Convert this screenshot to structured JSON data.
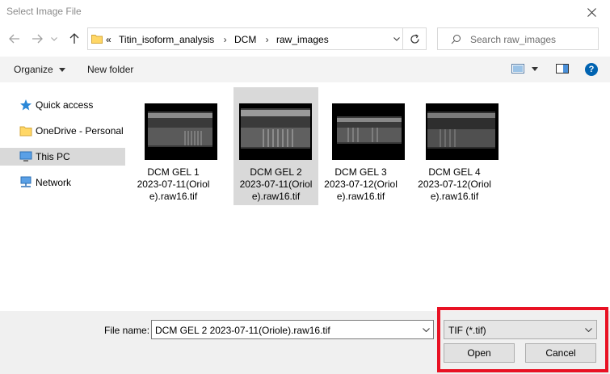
{
  "window": {
    "title": "Select Image File"
  },
  "address": {
    "chevron": "«",
    "crumbs": [
      "Titin_isoform_analysis",
      "DCM",
      "raw_images"
    ]
  },
  "search": {
    "placeholder": "Search raw_images"
  },
  "toolbar": {
    "organize": "Organize",
    "new_folder": "New folder"
  },
  "nav_pane": [
    {
      "label": "Quick access",
      "icon": "star-icon"
    },
    {
      "label": "OneDrive - Personal",
      "icon": "folder-icon"
    },
    {
      "label": "This PC",
      "icon": "computer-icon",
      "selected": true
    },
    {
      "label": "Network",
      "icon": "network-icon"
    }
  ],
  "files": [
    {
      "line1": "DCM GEL 1",
      "line2": "2023-07-11(Oriol",
      "line3": "e).raw16.tif",
      "selected": false
    },
    {
      "line1": "DCM GEL 2",
      "line2": "2023-07-11(Oriol",
      "line3": "e).raw16.tif",
      "selected": true
    },
    {
      "line1": "DCM GEL 3",
      "line2": "2023-07-12(Oriol",
      "line3": "e).raw16.tif",
      "selected": false
    },
    {
      "line1": "DCM GEL 4",
      "line2": "2023-07-12(Oriol",
      "line3": "e).raw16.tif",
      "selected": false
    }
  ],
  "bottom": {
    "file_name_label": "File name:",
    "file_name_value": "DCM GEL 2 2023-07-11(Oriole).raw16.tif",
    "filter_value": "TIF (*.tif)",
    "open_label": "Open",
    "cancel_label": "Cancel"
  },
  "colors": {
    "highlight": "#e81123",
    "selection": "#d9d9d9",
    "help": "#0063b1"
  }
}
